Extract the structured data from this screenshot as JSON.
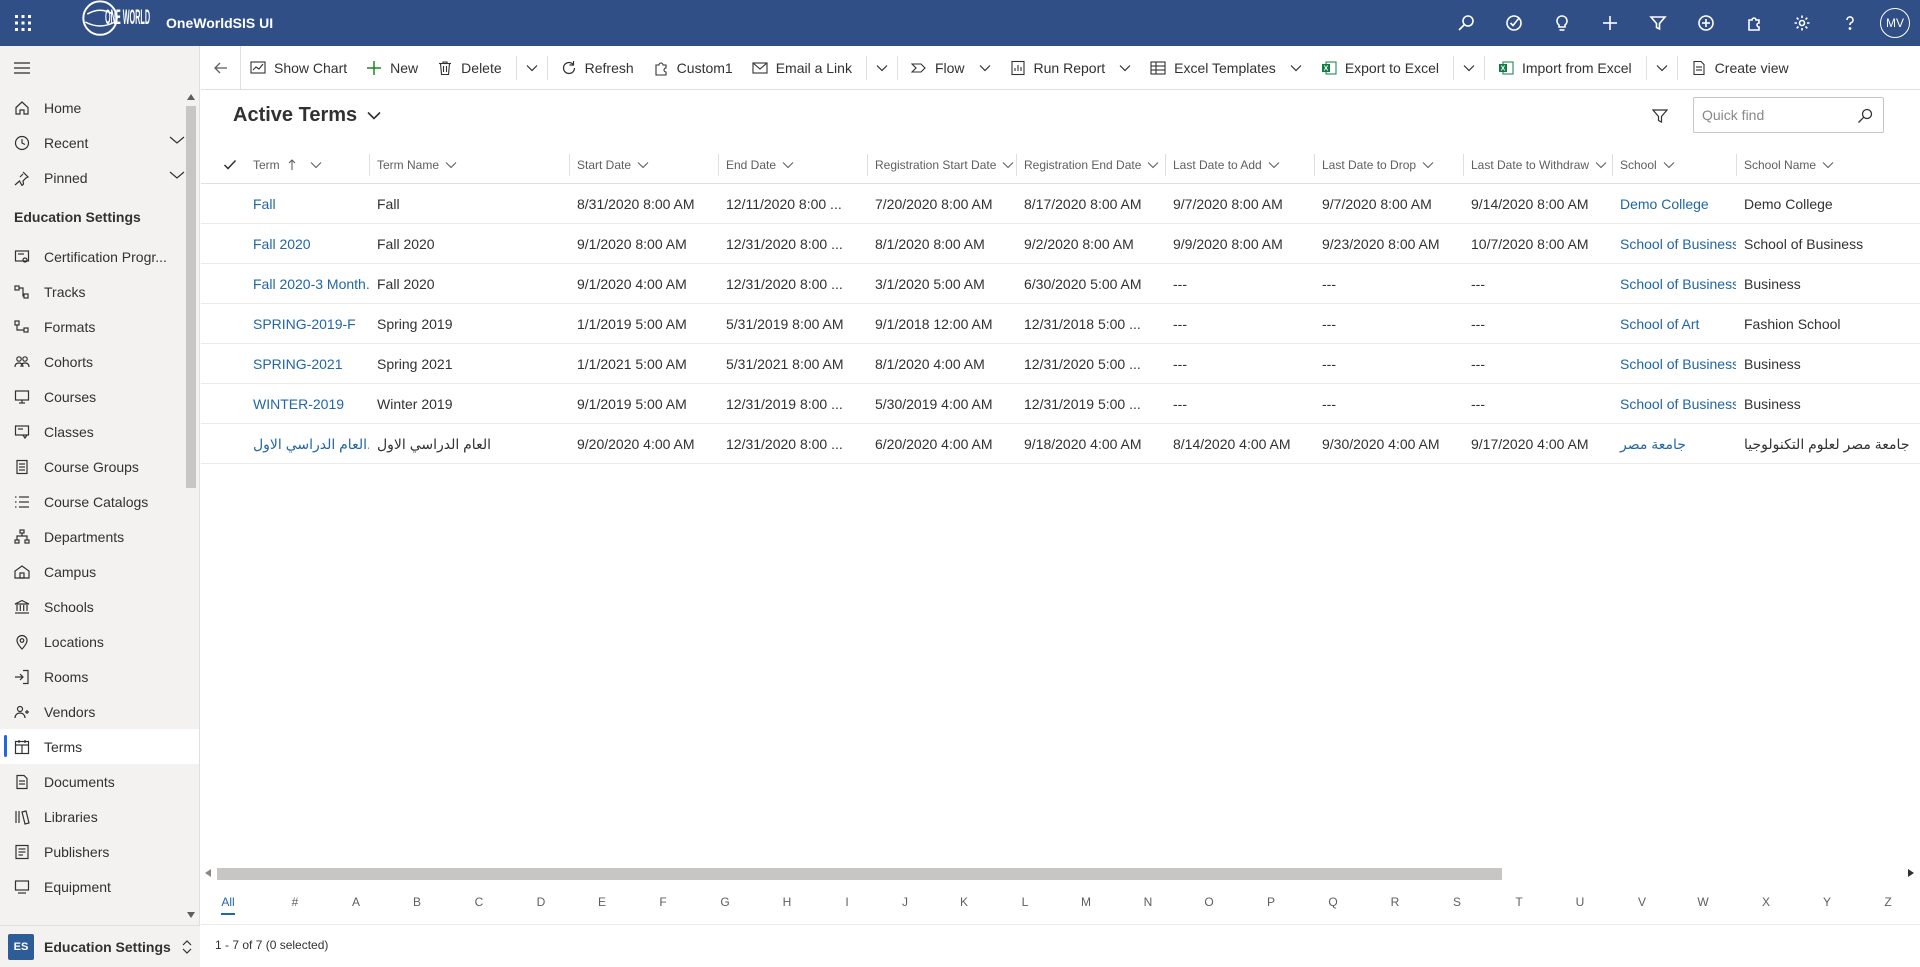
{
  "app": {
    "title": "OneWorldSIS UI",
    "logo_text": "ONE WORLD",
    "user_initials": "MV"
  },
  "topbar": {
    "icons": [
      "search-icon",
      "task-icon",
      "lightbulb-icon",
      "plus-icon",
      "filter-icon",
      "circle-plus-icon",
      "puzzle-icon",
      "gear-icon",
      "help-icon"
    ]
  },
  "sidebar": {
    "top_items": [
      {
        "label": "Home",
        "icon": "home-icon"
      },
      {
        "label": "Recent",
        "icon": "clock-icon",
        "expandable": true
      },
      {
        "label": "Pinned",
        "icon": "pin-icon",
        "expandable": true
      }
    ],
    "group_title": "Education Settings",
    "items": [
      {
        "label": "Certification Progr...",
        "icon": "certificate-icon"
      },
      {
        "label": "Tracks",
        "icon": "tracks-icon"
      },
      {
        "label": "Formats",
        "icon": "formats-icon"
      },
      {
        "label": "Cohorts",
        "icon": "people-icon"
      },
      {
        "label": "Courses",
        "icon": "monitor-icon"
      },
      {
        "label": "Classes",
        "icon": "classes-icon"
      },
      {
        "label": "Course Groups",
        "icon": "book-stack-icon"
      },
      {
        "label": "Course Catalogs",
        "icon": "list-icon"
      },
      {
        "label": "Departments",
        "icon": "org-icon"
      },
      {
        "label": "Campus",
        "icon": "campus-icon"
      },
      {
        "label": "Schools",
        "icon": "bank-icon"
      },
      {
        "label": "Locations",
        "icon": "location-icon"
      },
      {
        "label": "Rooms",
        "icon": "door-icon"
      },
      {
        "label": "Vendors",
        "icon": "vendor-icon"
      },
      {
        "label": "Terms",
        "icon": "calendar-icon",
        "selected": true
      },
      {
        "label": "Documents",
        "icon": "document-icon"
      },
      {
        "label": "Libraries",
        "icon": "library-icon"
      },
      {
        "label": "Publishers",
        "icon": "publisher-icon"
      },
      {
        "label": "Equipment",
        "icon": "equipment-icon"
      }
    ],
    "area": {
      "badge": "ES",
      "label": "Education Settings"
    }
  },
  "commandbar": {
    "show_chart": "Show Chart",
    "new": "New",
    "delete": "Delete",
    "refresh": "Refresh",
    "custom1": "Custom1",
    "email_link": "Email a Link",
    "flow": "Flow",
    "run_report": "Run Report",
    "excel_templates": "Excel Templates",
    "export_excel": "Export to Excel",
    "import_excel": "Import from Excel",
    "create_view": "Create view"
  },
  "view": {
    "title": "Active Terms",
    "quick_find_placeholder": "Quick find"
  },
  "grid": {
    "columns": [
      "Term",
      "Term Name",
      "Start Date",
      "End Date",
      "Registration Start Date",
      "Registration End Date",
      "Last Date to Add",
      "Last Date to Drop",
      "Last Date to Withdraw",
      "School",
      "School Name"
    ],
    "rows": [
      [
        "Fall",
        "Fall",
        "8/31/2020 8:00 AM",
        "12/11/2020 8:00 ...",
        "7/20/2020 8:00 AM",
        "8/17/2020 8:00 AM",
        "9/7/2020 8:00 AM",
        "9/7/2020 8:00 AM",
        "9/14/2020 8:00 AM",
        "Demo College",
        "Demo College"
      ],
      [
        "Fall 2020",
        "Fall 2020",
        "9/1/2020 8:00 AM",
        "12/31/2020 8:00 ...",
        "8/1/2020 8:00 AM",
        "9/2/2020 8:00 AM",
        "9/9/2020 8:00 AM",
        "9/23/2020 8:00 AM",
        "10/7/2020 8:00 AM",
        "School of Business.",
        "School of Business"
      ],
      [
        "Fall 2020-3 Month.",
        "Fall 2020",
        "9/1/2020 4:00 AM",
        "12/31/2020 8:00 ...",
        "3/1/2020 5:00 AM",
        "6/30/2020 5:00 AM",
        "---",
        "---",
        "---",
        "School of Business.",
        "Business"
      ],
      [
        "SPRING-2019-F",
        "Spring 2019",
        "1/1/2019 5:00 AM",
        "5/31/2019 8:00 AM",
        "9/1/2018 12:00 AM",
        "12/31/2018 5:00 ...",
        "---",
        "---",
        "---",
        "School of Art",
        "Fashion School"
      ],
      [
        "SPRING-2021",
        "Spring 2021",
        "1/1/2021 5:00 AM",
        "5/31/2021 8:00 AM",
        "8/1/2020 4:00 AM",
        "12/31/2020 5:00 ...",
        "---",
        "---",
        "---",
        "School of Business.",
        "Business"
      ],
      [
        "WINTER-2019",
        "Winter 2019",
        "9/1/2019 5:00 AM",
        "12/31/2019 8:00 ...",
        "5/30/2019 4:00 AM",
        "12/31/2019 5:00 ...",
        "---",
        "---",
        "---",
        "School of Business.",
        "Business"
      ],
      [
        "العام الدراسي الاول...",
        "العام الدراسي الاول",
        "9/20/2020 4:00 AM",
        "12/31/2020 8:00 ...",
        "6/20/2020 4:00 AM",
        "9/18/2020 4:00 AM",
        "8/14/2020 4:00 AM",
        "9/30/2020 4:00 AM",
        "9/17/2020 4:00 AM",
        "جامعة مصر",
        "جامعة مصر لعلوم التكنولوجيا"
      ]
    ]
  },
  "alphabet": [
    "All",
    "#",
    "A",
    "B",
    "C",
    "D",
    "E",
    "F",
    "G",
    "H",
    "I",
    "J",
    "K",
    "L",
    "M",
    "N",
    "O",
    "P",
    "Q",
    "R",
    "S",
    "T",
    "U",
    "V",
    "W",
    "X",
    "Y",
    "Z"
  ],
  "status": "1 - 7 of 7 (0 selected)",
  "colors": {
    "header": "#2f4f86",
    "link": "#2266a6",
    "selected_accent": "#2266e3"
  }
}
